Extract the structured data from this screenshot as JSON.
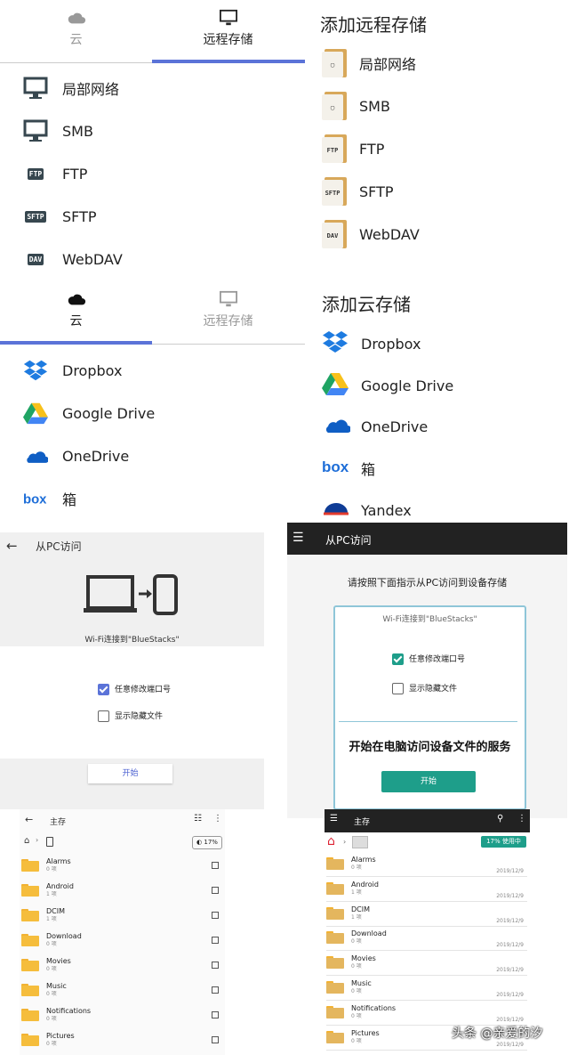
{
  "panelA": {
    "tabs": [
      {
        "label": "云",
        "icon": "cloud-icon",
        "active": false
      },
      {
        "label": "远程存储",
        "icon": "monitor-icon",
        "active": true
      }
    ],
    "items": [
      {
        "label": "局部网络",
        "icon": "monitor-icon"
      },
      {
        "label": "SMB",
        "icon": "monitor-icon"
      },
      {
        "label": "FTP",
        "icon": "ftp-icon",
        "badge": "FTP"
      },
      {
        "label": "SFTP",
        "icon": "sftp-icon",
        "badge": "SFTP"
      },
      {
        "label": "WebDAV",
        "icon": "dav-icon",
        "badge": "DAV"
      }
    ]
  },
  "panelA2": {
    "tabs": [
      {
        "label": "云",
        "icon": "cloud-icon",
        "active": true
      },
      {
        "label": "远程存储",
        "icon": "monitor-icon",
        "active": false
      }
    ],
    "items": [
      {
        "label": "Dropbox",
        "icon": "dropbox-icon"
      },
      {
        "label": "Google Drive",
        "icon": "google-drive-icon"
      },
      {
        "label": "OneDrive",
        "icon": "onedrive-icon"
      },
      {
        "label": "箱",
        "icon": "box-icon"
      }
    ]
  },
  "panelB": {
    "remote_title": "添加远程存储",
    "remote_items": [
      {
        "label": "局部网络",
        "badge": "▢"
      },
      {
        "label": "SMB",
        "badge": "▢"
      },
      {
        "label": "FTP",
        "badge": "FTP"
      },
      {
        "label": "SFTP",
        "badge": "SFTP"
      },
      {
        "label": "WebDAV",
        "badge": "DAV"
      }
    ],
    "cloud_title": "添加云存储",
    "cloud_items": [
      {
        "label": "Dropbox"
      },
      {
        "label": "Google Drive"
      },
      {
        "label": "OneDrive"
      },
      {
        "label": "箱"
      },
      {
        "label": "Yandex"
      }
    ]
  },
  "panelC": {
    "title": "从PC访问",
    "wifi": "Wi-Fi连接到\"BlueStacks\"",
    "opt_port": "任意修改端口号",
    "opt_hidden": "显示隐藏文件",
    "start": "开始"
  },
  "panelD": {
    "title": "从PC访问",
    "instruction": "请按照下面指示从PC访问到设备存储",
    "wifi": "Wi-Fi连接到\"BlueStacks\"",
    "opt_port": "任意修改端口号",
    "opt_hidden": "显示隐藏文件",
    "service": "开始在电脑访问设备文件的服务",
    "start": "开始",
    "accent": "#1e9e8a"
  },
  "panelE": {
    "title": "主存",
    "usage": "17%",
    "folders": [
      {
        "name": "Alarms",
        "count": "0 项"
      },
      {
        "name": "Android",
        "count": "1 项"
      },
      {
        "name": "DCIM",
        "count": "1 项"
      },
      {
        "name": "Download",
        "count": "0 项"
      },
      {
        "name": "Movies",
        "count": "0 项"
      },
      {
        "name": "Music",
        "count": "0 项"
      },
      {
        "name": "Notifications",
        "count": "0 项"
      },
      {
        "name": "Pictures",
        "count": "0 项"
      }
    ]
  },
  "panelF": {
    "title": "主存",
    "usage": "17% 使用中",
    "folders": [
      {
        "name": "Alarms",
        "count": "0 项",
        "date": "2019/12/9"
      },
      {
        "name": "Android",
        "count": "1 项",
        "date": "2019/12/9"
      },
      {
        "name": "DCIM",
        "count": "1 项",
        "date": "2019/12/9"
      },
      {
        "name": "Download",
        "count": "0 项",
        "date": "2019/12/9"
      },
      {
        "name": "Movies",
        "count": "0 项",
        "date": "2019/12/9"
      },
      {
        "name": "Music",
        "count": "0 项",
        "date": "2019/12/9"
      },
      {
        "name": "Notifications",
        "count": "0 项",
        "date": "2019/12/9"
      },
      {
        "name": "Pictures",
        "count": "0 项",
        "date": "2019/12/9"
      }
    ]
  },
  "watermark": "头条 @亲爱的汐"
}
